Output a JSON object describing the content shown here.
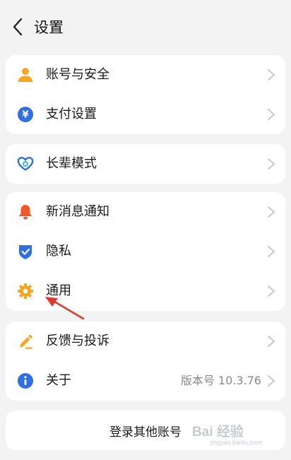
{
  "header": {
    "title": "设置",
    "back_icon": "chevron-left-icon"
  },
  "groups": [
    {
      "items": [
        {
          "label": "账号与安全",
          "icon": "user-icon",
          "icon_color": "#f5a623"
        },
        {
          "label": "支付设置",
          "icon": "yuan-icon",
          "icon_color": "#2f6fe0"
        }
      ]
    },
    {
      "items": [
        {
          "label": "长辈模式",
          "icon": "heart-icon",
          "icon_color": "#2f6fe0"
        }
      ]
    },
    {
      "items": [
        {
          "label": "新消息通知",
          "icon": "bell-icon",
          "icon_color": "#f05a28"
        },
        {
          "label": "隐私",
          "icon": "shield-icon",
          "icon_color": "#2f6fe0"
        },
        {
          "label": "通用",
          "icon": "gear-icon",
          "icon_color": "#f5a623"
        }
      ]
    },
    {
      "items": [
        {
          "label": "反馈与投诉",
          "icon": "pencil-icon",
          "icon_color": "#f5a623"
        },
        {
          "label": "关于",
          "icon": "info-icon",
          "icon_color": "#2f6fe0",
          "value": "版本号 10.3.76"
        }
      ]
    }
  ],
  "login_other": "登录其他账号",
  "watermark": {
    "main": "Bai 经验",
    "sub": "jingyan.baidu.com"
  },
  "colors": {
    "background": "#f3f3f3",
    "card": "#ffffff",
    "annotation_arrow": "#e03a2f"
  }
}
